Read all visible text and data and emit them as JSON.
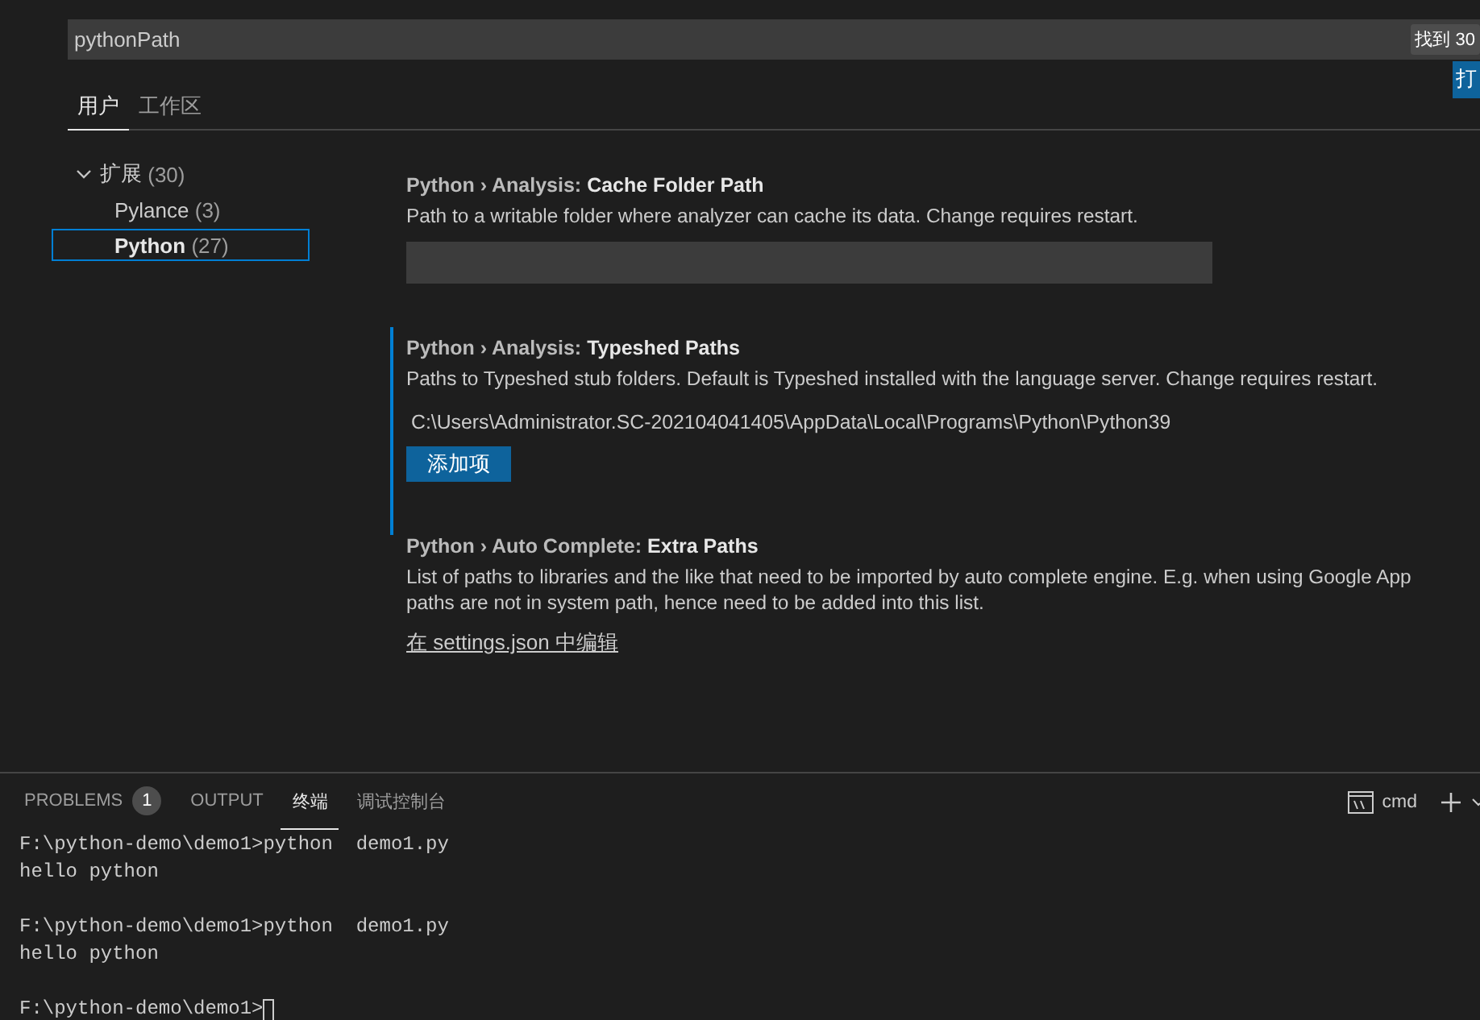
{
  "search": {
    "value": "pythonPath",
    "result_badge": "找到 30"
  },
  "tabs": [
    {
      "label": "用户",
      "selected": true
    },
    {
      "label": "工作区",
      "selected": false
    }
  ],
  "action_button": "打",
  "tree": [
    {
      "label": "扩展",
      "count": "(30)",
      "expanded": true,
      "selected": false,
      "children": [
        {
          "label": "Pylance",
          "count": "(3)",
          "selected": false
        },
        {
          "label": "Python",
          "count": "(27)",
          "selected": true
        }
      ]
    }
  ],
  "settings": [
    {
      "kind": "text",
      "category": "Python › Analysis: ",
      "name": "Cache Folder Path",
      "description": [
        "Path to a writable folder where analyzer can cache its data. Change requires restart."
      ],
      "focused": false
    },
    {
      "kind": "list",
      "category": "Python › Analysis: ",
      "name": "Typeshed Paths",
      "description": [
        "Paths to Typeshed stub folders. Default is Typeshed installed with the language server. Change requires restart."
      ],
      "items": [
        "C:\\Users\\Administrator.SC-202104041405\\AppData\\Local\\Programs\\Python\\Python39"
      ],
      "add_button": "添加项",
      "focused": true
    },
    {
      "kind": "link",
      "category": "Python › Auto Complete: ",
      "name": "Extra Paths",
      "description": [
        "List of paths to libraries and the like that need to be imported by auto complete engine. E.g. when using Google App",
        "paths are not in system path, hence need to be added into this list."
      ],
      "link": "在 settings.json 中编辑",
      "focused": false
    }
  ],
  "panel": {
    "tabs": [
      {
        "label": "PROBLEMS",
        "badge": "1",
        "selected": false
      },
      {
        "label": "OUTPUT",
        "selected": false
      },
      {
        "label": "终端",
        "selected": true
      },
      {
        "label": "调试控制台",
        "selected": false
      }
    ],
    "terminal_name": "cmd",
    "terminal_blocks": [
      [
        "F:\\python-demo\\demo1>python  demo1.py",
        "hello python"
      ],
      [
        "F:\\python-demo\\demo1>python  demo1.py",
        "hello python"
      ],
      [
        "F:\\python-demo\\demo1>"
      ]
    ],
    "cursor": true
  }
}
